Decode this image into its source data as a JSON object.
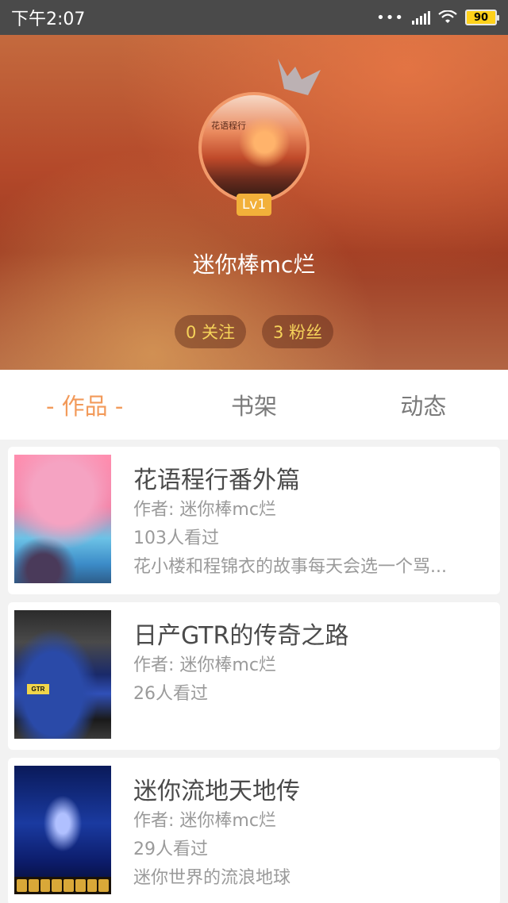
{
  "status_bar": {
    "time": "下午2:07",
    "dots": "•••",
    "battery": "90",
    "battery_color": "#ffd11a"
  },
  "profile": {
    "avatar_caption": "花语程行",
    "level": "Lv1",
    "username": "迷你棒mc烂",
    "following": "0 关注",
    "followers": "3 粉丝",
    "stat_color": "#f6d35a"
  },
  "tabs": [
    {
      "label": "- 作品 -",
      "active": true
    },
    {
      "label": "书架",
      "active": false
    },
    {
      "label": "动态",
      "active": false
    }
  ],
  "accent_color": "#f29a5a",
  "works": [
    {
      "title": "花语程行番外篇",
      "author": "作者: 迷你棒mc烂",
      "views": "103人看过",
      "description": "花小楼和程锦衣的故事每天会选一个骂...",
      "thumbnail_icon": "cherry-blossom-scene-thumbnail"
    },
    {
      "title": "日产GTR的传奇之路",
      "author": "作者: 迷你棒mc烂",
      "views": "26人看过",
      "description": "",
      "thumbnail_icon": "blue-gtr-car-thumbnail",
      "plate_text": "GTR"
    },
    {
      "title": "迷你流地天地传",
      "author": "作者: 迷你棒mc烂",
      "views": "29人看过",
      "description": "迷你世界的流浪地球",
      "thumbnail_icon": "spaceship-game-thumbnail"
    }
  ]
}
